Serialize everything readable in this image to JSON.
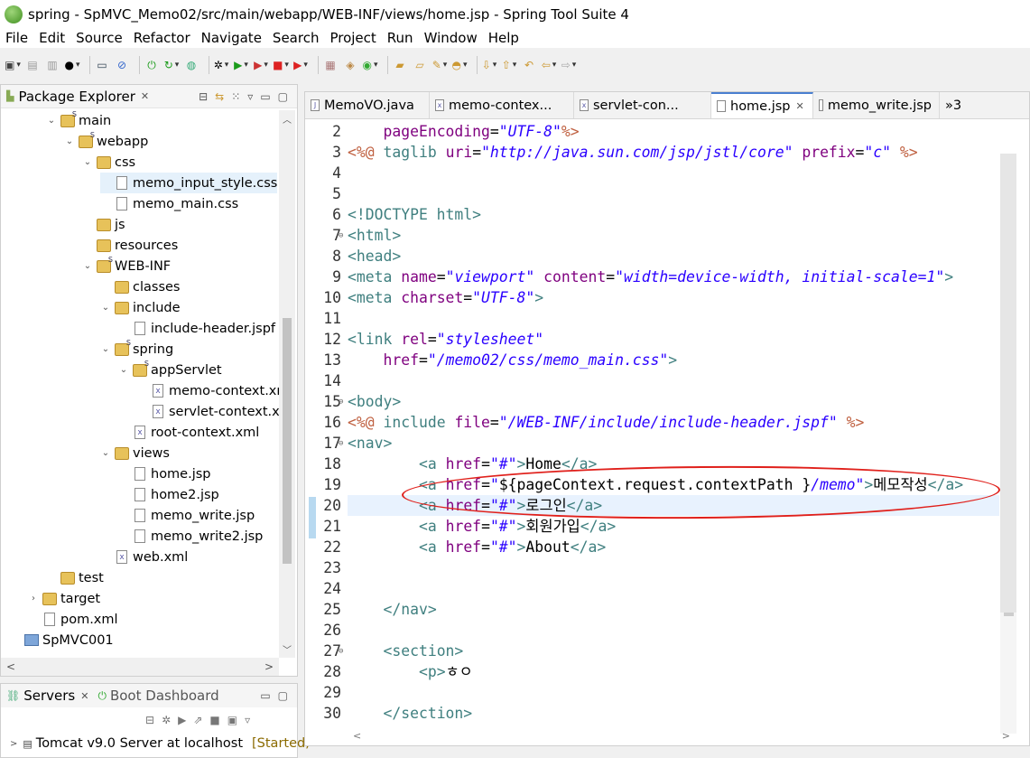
{
  "window": {
    "title": "spring - SpMVC_Memo02/src/main/webapp/WEB-INF/views/home.jsp - Spring Tool Suite 4"
  },
  "menu": [
    "File",
    "Edit",
    "Source",
    "Refactor",
    "Navigate",
    "Search",
    "Project",
    "Run",
    "Window",
    "Help"
  ],
  "package_explorer": {
    "title": "Package Explorer",
    "tree": [
      {
        "label": "main",
        "icon": "package-folder",
        "level": 2,
        "toggle": "expanded"
      },
      {
        "label": "webapp",
        "icon": "package-folder",
        "level": 3,
        "toggle": "expanded"
      },
      {
        "label": "css",
        "icon": "folder",
        "level": 4,
        "toggle": "expanded"
      },
      {
        "label": "memo_input_style.css",
        "icon": "file",
        "level": 5,
        "toggle": "",
        "selected": true
      },
      {
        "label": "memo_main.css",
        "icon": "file",
        "level": 5,
        "toggle": ""
      },
      {
        "label": "js",
        "icon": "folder",
        "level": 4,
        "toggle": ""
      },
      {
        "label": "resources",
        "icon": "folder",
        "level": 4,
        "toggle": ""
      },
      {
        "label": "WEB-INF",
        "icon": "package-folder",
        "level": 4,
        "toggle": "expanded"
      },
      {
        "label": "classes",
        "icon": "folder",
        "level": 5,
        "toggle": ""
      },
      {
        "label": "include",
        "icon": "folder",
        "level": 5,
        "toggle": "expanded"
      },
      {
        "label": "include-header.jspf",
        "icon": "file",
        "level": 6,
        "toggle": ""
      },
      {
        "label": "spring",
        "icon": "package-folder",
        "level": 5,
        "toggle": "expanded"
      },
      {
        "label": "appServlet",
        "icon": "package-folder",
        "level": 6,
        "toggle": "expanded"
      },
      {
        "label": "memo-context.xml",
        "icon": "xml",
        "level": 7,
        "toggle": ""
      },
      {
        "label": "servlet-context.xml",
        "icon": "xml",
        "level": 7,
        "toggle": ""
      },
      {
        "label": "root-context.xml",
        "icon": "xml",
        "level": 6,
        "toggle": ""
      },
      {
        "label": "views",
        "icon": "folder",
        "level": 5,
        "toggle": "expanded"
      },
      {
        "label": "home.jsp",
        "icon": "file",
        "level": 6,
        "toggle": ""
      },
      {
        "label": "home2.jsp",
        "icon": "file",
        "level": 6,
        "toggle": ""
      },
      {
        "label": "memo_write.jsp",
        "icon": "file",
        "level": 6,
        "toggle": ""
      },
      {
        "label": "memo_write2.jsp",
        "icon": "file",
        "level": 6,
        "toggle": ""
      },
      {
        "label": "web.xml",
        "icon": "xml",
        "level": 5,
        "toggle": ""
      },
      {
        "label": "test",
        "icon": "folder",
        "level": 2,
        "toggle": ""
      },
      {
        "label": "target",
        "icon": "folder",
        "level": 1,
        "toggle": "collapsed"
      },
      {
        "label": "pom.xml",
        "icon": "file",
        "level": 1,
        "toggle": ""
      },
      {
        "label": "SpMVC001",
        "icon": "project",
        "level": 0,
        "toggle": ""
      }
    ]
  },
  "servers": {
    "tab1": "Servers",
    "tab2": "Boot Dashboard",
    "server_name": "Tomcat v9.0 Server at localhost",
    "server_status": "[Started,"
  },
  "editor": {
    "tabs": [
      {
        "label": "MemoVO.java",
        "icon": "J",
        "active": false
      },
      {
        "label": "memo-contex...",
        "icon": "x",
        "active": false
      },
      {
        "label": "servlet-con...",
        "icon": "x",
        "active": false
      },
      {
        "label": "home.jsp",
        "icon": "",
        "active": true
      },
      {
        "label": "memo_write.jsp",
        "icon": "",
        "active": false
      }
    ],
    "overflow": "»3",
    "lines": [
      {
        "n": "2",
        "fold": "",
        "html": "    <span class=\"at\">pageEncoding</span>=<span class=\"va\">\"UTF-8\"</span><span class=\"dir\">%&gt;</span>"
      },
      {
        "n": "3",
        "fold": "",
        "html": "<span class=\"dir\">&lt;%@</span> <span class=\"tg\">taglib</span> <span class=\"at\">uri</span>=<span class=\"va\">\"http://java.sun.com/jsp/jstl/core\"</span> <span class=\"at\">prefix</span>=<span class=\"va\">\"c\"</span> <span class=\"dir\">%&gt;</span>"
      },
      {
        "n": "4",
        "fold": "",
        "html": ""
      },
      {
        "n": "5",
        "fold": "",
        "html": ""
      },
      {
        "n": "6",
        "fold": "",
        "html": "<span class=\"tg\">&lt;!DOCTYPE html&gt;</span>"
      },
      {
        "n": "7",
        "fold": "⊖",
        "html": "<span class=\"tg\">&lt;html&gt;</span>"
      },
      {
        "n": "8",
        "fold": "",
        "html": "<span class=\"tg\">&lt;head&gt;</span>"
      },
      {
        "n": "9",
        "fold": "",
        "html": "<span class=\"tg\">&lt;meta</span> <span class=\"at\">name</span>=<span class=\"va\">\"viewport\"</span> <span class=\"at\">content</span>=<span class=\"va\">\"width=device-width, initial-scale=1\"</span><span class=\"tg\">&gt;</span>"
      },
      {
        "n": "10",
        "fold": "",
        "html": "<span class=\"tg\">&lt;meta</span> <span class=\"at\">charset</span>=<span class=\"va\">\"UTF-8\"</span><span class=\"tg\">&gt;</span>"
      },
      {
        "n": "11",
        "fold": "",
        "html": ""
      },
      {
        "n": "12",
        "fold": "",
        "html": "<span class=\"tg\">&lt;link</span> <span class=\"at\">rel</span>=<span class=\"va\">\"stylesheet\"</span>"
      },
      {
        "n": "13",
        "fold": "",
        "html": "    <span class=\"at\">href</span>=<span class=\"va\">\"/memo02/css/memo_main.css\"</span><span class=\"tg\">&gt;</span>"
      },
      {
        "n": "14",
        "fold": "",
        "html": ""
      },
      {
        "n": "15",
        "fold": "⊖",
        "html": "<span class=\"tg\">&lt;body&gt;</span>"
      },
      {
        "n": "16",
        "fold": "",
        "html": "<span class=\"dir\">&lt;%@</span> <span class=\"tg\">include</span> <span class=\"at\">file</span>=<span class=\"va\">\"/WEB-INF/include/include-header.jspf\"</span> <span class=\"dir\">%&gt;</span>"
      },
      {
        "n": "17",
        "fold": "⊖",
        "html": "<span class=\"tg\">&lt;nav&gt;</span>"
      },
      {
        "n": "18",
        "fold": "",
        "html": "        <span class=\"tg\">&lt;a</span> <span class=\"at\">href</span>=<span class=\"va\">\"#\"</span><span class=\"tg\">&gt;</span>Home<span class=\"tg\">&lt;/a&gt;</span>"
      },
      {
        "n": "19",
        "fold": "",
        "html": "        <span class=\"tg\">&lt;a</span> <span class=\"at\">href</span>=<span class=\"va\">\"</span>${pageContext.request.contextPath }<span class=\"va\">/memo\"</span><span class=\"tg\">&gt;</span>메모작성<span class=\"tg\">&lt;/a&gt;</span>"
      },
      {
        "n": "20",
        "fold": "",
        "html": "        <span class=\"tg\">&lt;a</span> <span class=\"at\">href</span>=<span class=\"va\">\"#\"</span><span class=\"tg\">&gt;</span>로그인<span class=\"tg\">&lt;/a&gt;</span>"
      },
      {
        "n": "21",
        "fold": "",
        "html": "        <span class=\"tg\">&lt;a</span> <span class=\"at\">href</span>=<span class=\"va\">\"#\"</span><span class=\"tg\">&gt;</span>회원가입<span class=\"tg\">&lt;/a&gt;</span>"
      },
      {
        "n": "22",
        "fold": "",
        "html": "        <span class=\"tg\">&lt;a</span> <span class=\"at\">href</span>=<span class=\"va\">\"#\"</span><span class=\"tg\">&gt;</span>About<span class=\"tg\">&lt;/a&gt;</span>"
      },
      {
        "n": "23",
        "fold": "",
        "html": ""
      },
      {
        "n": "24",
        "fold": "",
        "html": ""
      },
      {
        "n": "25",
        "fold": "",
        "html": "    <span class=\"tg\">&lt;/nav&gt;</span>"
      },
      {
        "n": "26",
        "fold": "",
        "html": ""
      },
      {
        "n": "27",
        "fold": "⊖",
        "html": "    <span class=\"tg\">&lt;section&gt;</span>"
      },
      {
        "n": "28",
        "fold": "",
        "html": "        <span class=\"tg\">&lt;p&gt;</span>ㅎㅇ"
      },
      {
        "n": "29",
        "fold": "",
        "html": ""
      },
      {
        "n": "30",
        "fold": "",
        "html": "    <span class=\"tg\">&lt;/section&gt;</span>"
      }
    ],
    "current_line": "20",
    "annotation_color": "#e0201b"
  }
}
